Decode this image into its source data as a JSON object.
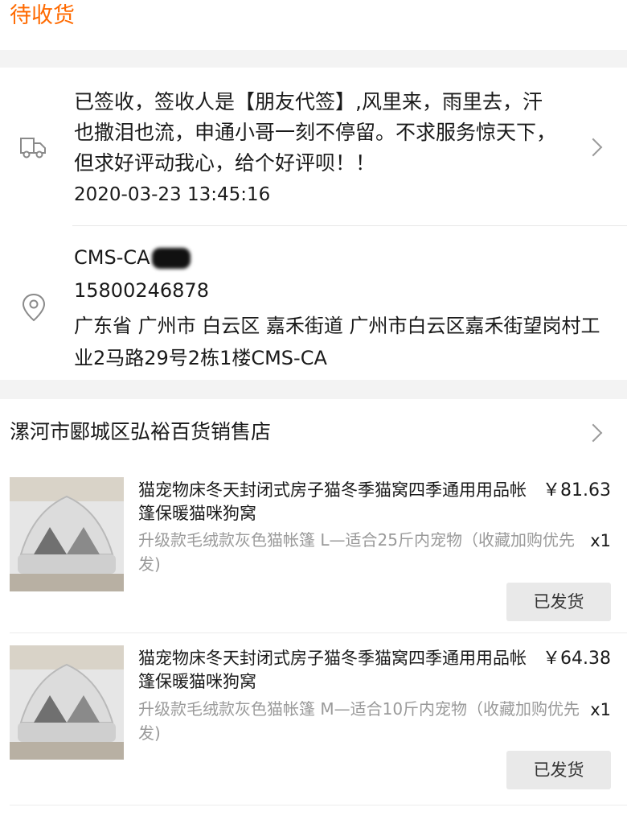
{
  "header": {
    "status": "待收货"
  },
  "logistics": {
    "message": "已签收，签收人是【朋友代签】,风里来，雨里去，汗也撒泪也流，申通小哥一刻不停留。不求服务惊天下，但求好评动我心，给个好评呗！！",
    "time": "2020-03-23 13:45:16"
  },
  "address": {
    "name": "CMS-CA",
    "phone": "15800246878",
    "full": "广东省 广州市 白云区 嘉禾街道 广州市白云区嘉禾街望岗村工业2马路29号2栋1楼CMS-CA"
  },
  "shop": {
    "name": "漯河市郾城区弘裕百货销售店",
    "items": [
      {
        "title": "猫宠物床冬天封闭式房子猫冬季猫窝四季通用用品帐篷保暖猫咪狗窝",
        "price": "￥81.63",
        "sku": "升级款毛绒款灰色猫帐篷 L—适合25斤内宠物（收藏加购优先发)",
        "qty": "x1",
        "status": "已发货"
      },
      {
        "title": "猫宠物床冬天封闭式房子猫冬季猫窝四季通用用品帐篷保暖猫咪狗窝",
        "price": "￥64.38",
        "sku": "升级款毛绒款灰色猫帐篷 M—适合10斤内宠物（收藏加购优先发)",
        "qty": "x1",
        "status": "已发货"
      }
    ]
  },
  "icons": {
    "logistics": "truck-icon",
    "address": "location-pin-icon",
    "chevron": "chevron-right-icon"
  },
  "colors": {
    "accent": "#ff6a00",
    "muted": "#9a9a9a"
  }
}
